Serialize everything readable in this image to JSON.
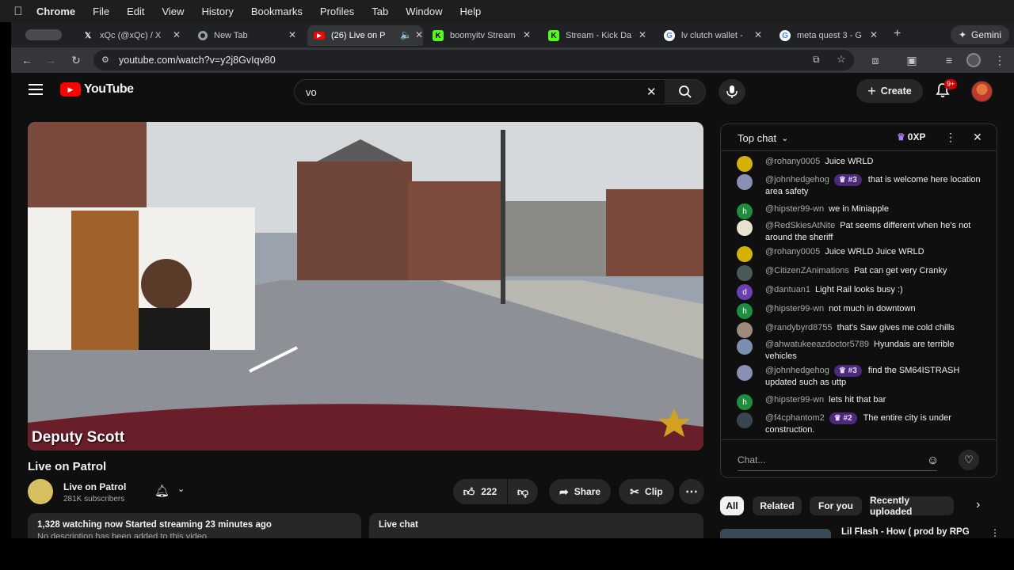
{
  "menubar": {
    "apple_icon": "apple-icon",
    "app": "Chrome",
    "items": [
      "File",
      "Edit",
      "View",
      "History",
      "Bookmarks",
      "Profiles",
      "Tab",
      "Window",
      "Help"
    ]
  },
  "tabs": [
    {
      "label": "xQc (@xQc) / X",
      "favicon": "x-icon"
    },
    {
      "label": "New Tab",
      "favicon": "chrome-icon"
    },
    {
      "label": "(26) Live on P",
      "favicon": "youtube-icon"
    },
    {
      "label": "boomyitv Stream",
      "favicon": "kick-icon"
    },
    {
      "label": "Stream - Kick Da",
      "favicon": "kick-icon"
    },
    {
      "label": "lv clutch wallet -",
      "favicon": "google-icon"
    },
    {
      "label": "meta quest 3 - G",
      "favicon": "google-icon"
    }
  ],
  "gemini_label": "Gemini",
  "omnibox": {
    "url": "youtube.com/watch?v=y2j8GvIqv80"
  },
  "youtube": {
    "logo_text": "YouTube",
    "search_value": "vo",
    "create_label": "Create",
    "notif_badge": "9+"
  },
  "video": {
    "overlay_name": "Deputy Scott",
    "title": "Live on Patrol",
    "channel_name": "Live on Patrol",
    "subscribers": "281K subscribers",
    "likes": "222",
    "share_label": "Share",
    "clip_label": "Clip"
  },
  "description": {
    "stats": "1,328 watching now  Started streaming 23 minutes ago",
    "text": "No description has been added to this video."
  },
  "live_chat_label": "Live chat",
  "chat": {
    "header": "Top chat",
    "xp": "0XP",
    "placeholder": "Chat...",
    "messages": [
      {
        "author": "@rohany0005",
        "text": "Juice WRLD",
        "badge": "",
        "avatar": "batman",
        "avatar_color": "#d4b200",
        "avatar_letter": ""
      },
      {
        "author": "@johnhedgehog",
        "text": "that is welcome here location area safety",
        "badge": "#3",
        "avatar": "hedgehog",
        "avatar_color": "#8a8fb5",
        "avatar_letter": ""
      },
      {
        "author": "@hipster99-wn",
        "text": "we in Miniapple",
        "badge": "",
        "avatar": "letter",
        "avatar_color": "#1e8e3e",
        "avatar_letter": "h"
      },
      {
        "author": "@RedSkiesAtNite",
        "text": "Pat seems different when he's not around the sheriff",
        "badge": "",
        "avatar": "logo",
        "avatar_color": "#e8e0d0",
        "avatar_letter": ""
      },
      {
        "author": "@rohany0005",
        "text": "Juice WRLD Juice WRLD",
        "badge": "",
        "avatar": "batman",
        "avatar_color": "#d4b200",
        "avatar_letter": ""
      },
      {
        "author": "@CitizenZAnimations",
        "text": "Pat can get very Cranky",
        "badge": "",
        "avatar": "photo",
        "avatar_color": "#4a5a58",
        "avatar_letter": ""
      },
      {
        "author": "@dantuan1",
        "text": "Light Rail looks busy :)",
        "badge": "",
        "avatar": "letter",
        "avatar_color": "#6a3fb5",
        "avatar_letter": "d"
      },
      {
        "author": "@hipster99-wn",
        "text": "not much in downtown",
        "badge": "",
        "avatar": "letter",
        "avatar_color": "#1e8e3e",
        "avatar_letter": "h"
      },
      {
        "author": "@randybyrd8755",
        "text": "that's Saw gives me cold chills",
        "badge": "",
        "avatar": "photo",
        "avatar_color": "#9c8a7a",
        "avatar_letter": ""
      },
      {
        "author": "@ahwatukeeazdoctor5789",
        "text": "Hyundais are terrible vehicles",
        "badge": "",
        "avatar": "photo",
        "avatar_color": "#7a8fb0",
        "avatar_letter": ""
      },
      {
        "author": "@johnhedgehog",
        "text": "find the SM64ISTRASH updated such as uttp",
        "badge": "#3",
        "avatar": "hedgehog",
        "avatar_color": "#8a8fb5",
        "avatar_letter": ""
      },
      {
        "author": "@hipster99-wn",
        "text": "lets hit that bar",
        "badge": "",
        "avatar": "letter",
        "avatar_color": "#1e8e3e",
        "avatar_letter": "h"
      },
      {
        "author": "@f4cphantom2",
        "text": "The entire city is under construction.",
        "badge": "#2",
        "avatar": "photo",
        "avatar_color": "#3a4550",
        "avatar_letter": ""
      }
    ]
  },
  "chips": [
    "All",
    "Related",
    "For you",
    "Recently uploaded"
  ],
  "recommendation": {
    "title": "Lil Flash - How ( prod by RPG"
  },
  "colors": {
    "youtube_red": "#ff0000",
    "kick_green": "#53fc18",
    "page_bg": "#0f0f0f",
    "badge_red": "#cc0000"
  }
}
